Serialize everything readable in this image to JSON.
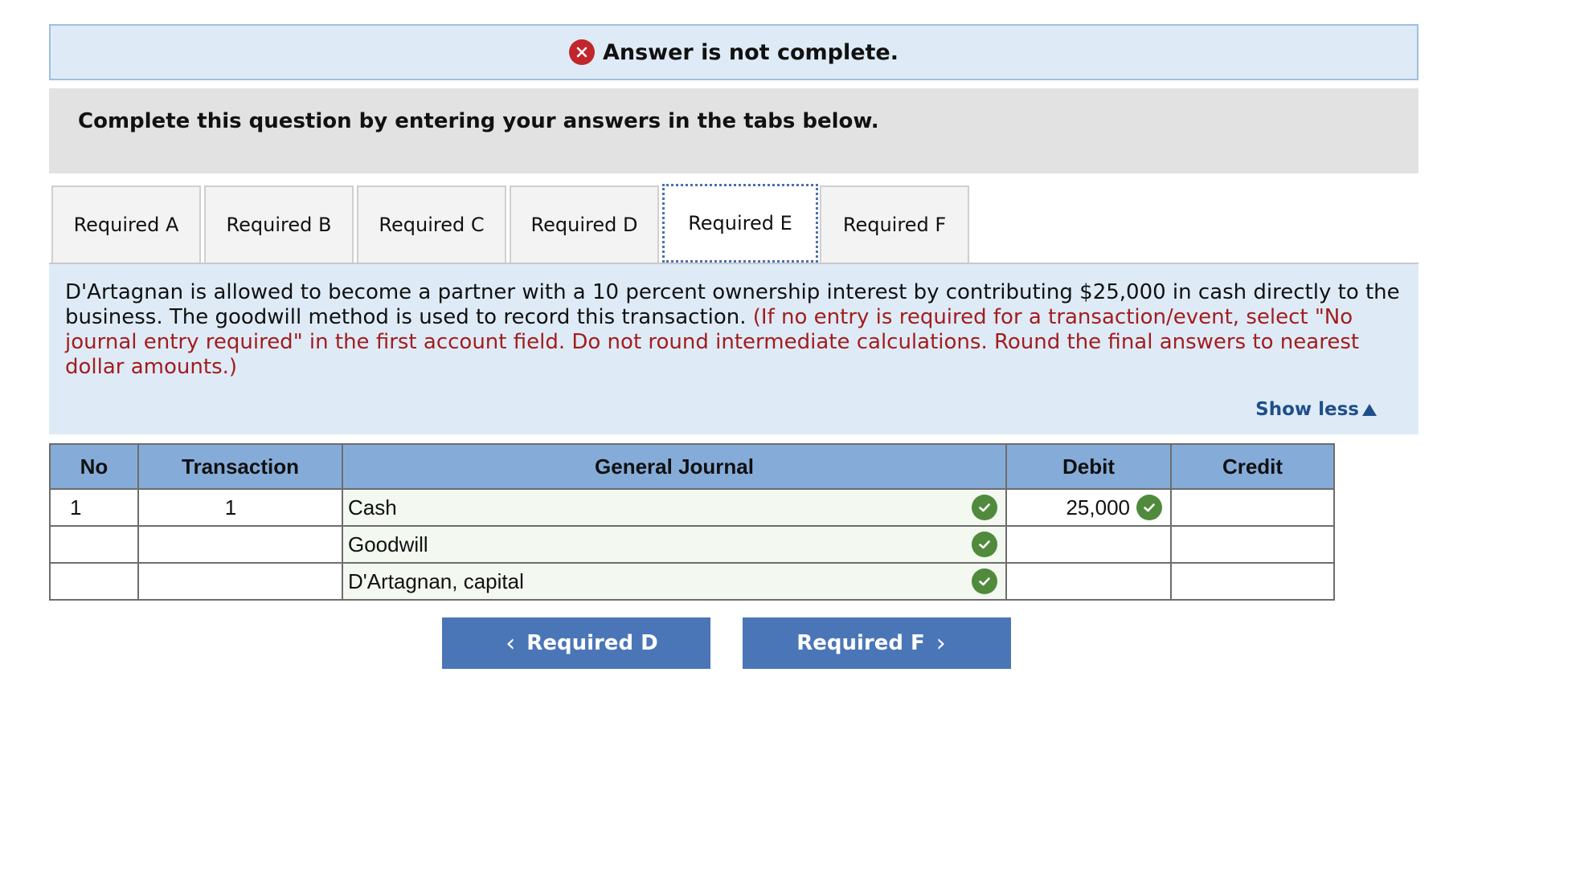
{
  "status": {
    "message": "Answer is not complete."
  },
  "instruction": "Complete this question by entering your answers in the tabs below.",
  "tabs": [
    {
      "label": "Required A"
    },
    {
      "label": "Required B"
    },
    {
      "label": "Required C"
    },
    {
      "label": "Required D"
    },
    {
      "label": "Required E",
      "active": true
    },
    {
      "label": "Required F"
    }
  ],
  "question": {
    "text": "D'Artagnan is allowed to become a partner with a 10 percent ownership interest by contributing $25,000 in cash directly to the business. The goodwill method is used to record this transaction.",
    "note": "(If no entry is required for a transaction/event, select \"No journal entry required\" in the first account field. Do not round intermediate calculations. Round the final answers to nearest dollar amounts.)",
    "toggle_label": "Show less"
  },
  "journal": {
    "headers": {
      "no": "No",
      "transaction": "Transaction",
      "general_journal": "General Journal",
      "debit": "Debit",
      "credit": "Credit"
    },
    "rows": [
      {
        "no": "1",
        "transaction": "1",
        "account": "Cash",
        "debit": "25,000",
        "credit": ""
      },
      {
        "no": "",
        "transaction": "",
        "account": "Goodwill",
        "debit": "",
        "credit": ""
      },
      {
        "no": "",
        "transaction": "",
        "account": "D'Artagnan, capital",
        "debit": "",
        "credit": ""
      }
    ]
  },
  "nav": {
    "prev_label": "Required D",
    "next_label": "Required F"
  },
  "colors": {
    "error": "#c0262b",
    "correct": "#4f8a3d",
    "header": "#85acd9",
    "button": "#4a76b8"
  }
}
